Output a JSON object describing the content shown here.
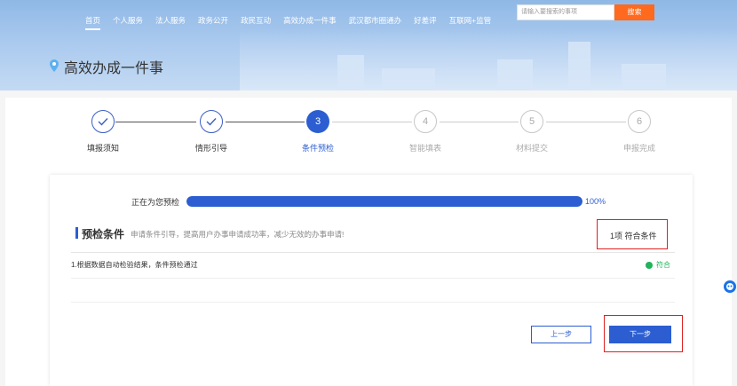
{
  "nav": {
    "items": [
      "首页",
      "个人服务",
      "法人服务",
      "政务公开",
      "政民互动",
      "高效办成一件事",
      "武汉都市圈通办",
      "好差评",
      "互联网+监管"
    ],
    "active_index": 0
  },
  "search": {
    "placeholder": "请输入要搜索的事项",
    "button_label": "搜索"
  },
  "page": {
    "title": "高效办成一件事"
  },
  "steps": [
    {
      "number": "",
      "label": "填报须知",
      "state": "done"
    },
    {
      "number": "",
      "label": "情形引导",
      "state": "done"
    },
    {
      "number": "3",
      "label": "条件预检",
      "state": "current"
    },
    {
      "number": "4",
      "label": "智能填表",
      "state": "todo"
    },
    {
      "number": "5",
      "label": "材料提交",
      "state": "todo"
    },
    {
      "number": "6",
      "label": "申报完成",
      "state": "todo"
    }
  ],
  "progress": {
    "label": "正在为您预检",
    "percent_text": "100%",
    "fraction": 1.0
  },
  "precheck": {
    "title": "预检条件",
    "description": "申请条件引导，提高用户办事申请成功率，减少无效的办事申请!",
    "count_text": "1项 符合条件",
    "result_text": "1.根据数据自动检验结果，条件预检通过",
    "status_text": "符合"
  },
  "actions": {
    "prev_label": "上一步",
    "next_label": "下一步"
  },
  "colors": {
    "primary": "#2c5ed2",
    "search": "#ff6a1e",
    "pass": "#1fb35a",
    "highlight": "#e02020"
  }
}
